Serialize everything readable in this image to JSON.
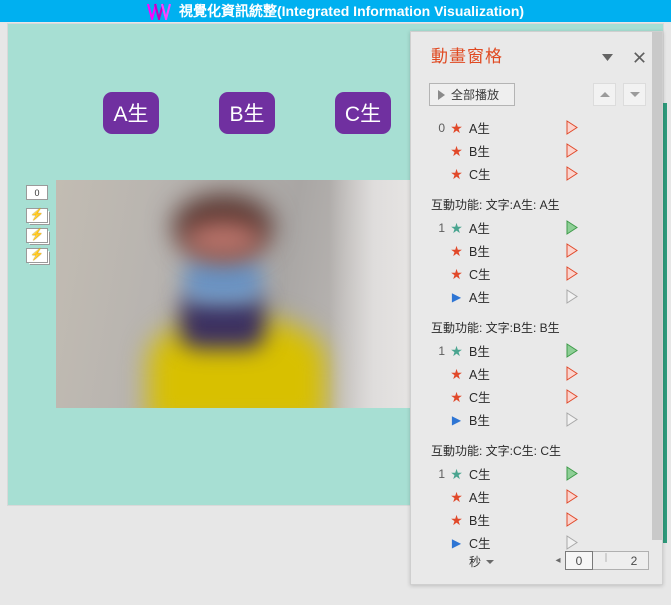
{
  "window": {
    "title": "視覺化資訊統整(Integrated Information Visualization)",
    "logo_icon": "double-w-logo-icon",
    "titlebar_color": "#00b0f0"
  },
  "slide": {
    "background_color": "#a7dfd3",
    "shapes": [
      {
        "label": "A生",
        "fill": "#7030a0",
        "text_color": "#ffffff"
      },
      {
        "label": "B生",
        "fill": "#7030a0",
        "text_color": "#ffffff"
      },
      {
        "label": "C生",
        "fill": "#7030a0",
        "text_color": "#ffffff"
      }
    ],
    "picture_alt": "blurred photo of a person in a yellow jacket",
    "gutter_tags": [
      {
        "label": "0",
        "icon": "number-tag"
      },
      {
        "label": "",
        "icon": "lightning-trigger-icon"
      },
      {
        "label": "",
        "icon": "lightning-trigger-icon"
      },
      {
        "label": "",
        "icon": "lightning-trigger-icon"
      }
    ]
  },
  "pane": {
    "title": "動畫窗格",
    "title_color": "#e04a22",
    "dropdown_icon": "chevron-down-icon",
    "close_icon": "close-icon",
    "play_all_label": "全部播放",
    "play_icon": "play-triangle-icon",
    "reorder_up_icon": "caret-up-icon",
    "reorder_down_icon": "caret-down-icon",
    "groups": [
      {
        "header": null,
        "rows": [
          {
            "num": "0",
            "icon": "star-red-icon",
            "label": "A生",
            "bar": "red"
          },
          {
            "num": "",
            "icon": "star-red-icon",
            "label": "B生",
            "bar": "red"
          },
          {
            "num": "",
            "icon": "star-red-icon",
            "label": "C生",
            "bar": "red"
          }
        ]
      },
      {
        "header": "互動功能: 文字:A生: A生",
        "rows": [
          {
            "num": "1",
            "icon": "star-green-icon",
            "label": "A生",
            "bar": "green"
          },
          {
            "num": "",
            "icon": "star-red-icon",
            "label": "B生",
            "bar": "red"
          },
          {
            "num": "",
            "icon": "star-red-icon",
            "label": "C生",
            "bar": "red"
          },
          {
            "num": "",
            "icon": "triangle-blue-icon",
            "label": "A生",
            "bar": "gray"
          }
        ]
      },
      {
        "header": "互動功能: 文字:B生: B生",
        "rows": [
          {
            "num": "1",
            "icon": "star-green-icon",
            "label": "B生",
            "bar": "green"
          },
          {
            "num": "",
            "icon": "star-red-icon",
            "label": "A生",
            "bar": "red"
          },
          {
            "num": "",
            "icon": "star-red-icon",
            "label": "C生",
            "bar": "red"
          },
          {
            "num": "",
            "icon": "triangle-blue-icon",
            "label": "B生",
            "bar": "gray"
          }
        ]
      },
      {
        "header": "互動功能: 文字:C生: C生",
        "rows": [
          {
            "num": "1",
            "icon": "star-green-icon",
            "label": "C生",
            "bar": "green"
          },
          {
            "num": "",
            "icon": "star-red-icon",
            "label": "A生",
            "bar": "red"
          },
          {
            "num": "",
            "icon": "star-red-icon",
            "label": "B生",
            "bar": "red"
          },
          {
            "num": "",
            "icon": "triangle-blue-icon",
            "label": "C生",
            "bar": "gray"
          }
        ]
      }
    ],
    "bottom": {
      "unit_label": "秒",
      "unit_dropdown_icon": "chevron-down-icon",
      "scroll_left_icon": "left-arrow-icon",
      "scroll_right_icon": "right-arrow-icon",
      "timeline_start": "0",
      "timeline_mid": "",
      "timeline_end": "2"
    }
  }
}
